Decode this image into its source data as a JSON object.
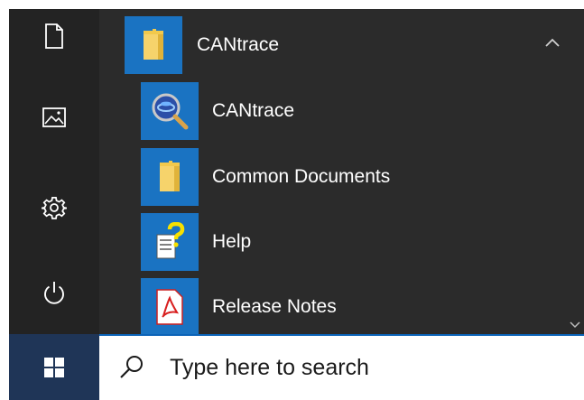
{
  "start_menu": {
    "rail": {
      "documents_icon": "document-icon",
      "pictures_icon": "pictures-icon",
      "settings_icon": "gear-icon",
      "power_icon": "power-icon"
    },
    "group": {
      "label": "CANtrace",
      "icon": "folder-icon",
      "expanded": true
    },
    "apps": [
      {
        "label": "CANtrace",
        "icon": "cantrace-app-icon"
      },
      {
        "label": "Common Documents",
        "icon": "folder-icon"
      },
      {
        "label": "Help",
        "icon": "help-file-icon"
      },
      {
        "label": "Release Notes",
        "icon": "pdf-icon"
      }
    ]
  },
  "taskbar": {
    "start_icon": "windows-logo-icon",
    "search": {
      "placeholder": "Type here to search",
      "icon": "search-icon"
    }
  },
  "colors": {
    "menu_background": "#2b2b2b",
    "rail_background": "#232323",
    "tile_accent": "#1a73c2",
    "start_button": "#1f3557",
    "search_border": "#0b63b8"
  }
}
